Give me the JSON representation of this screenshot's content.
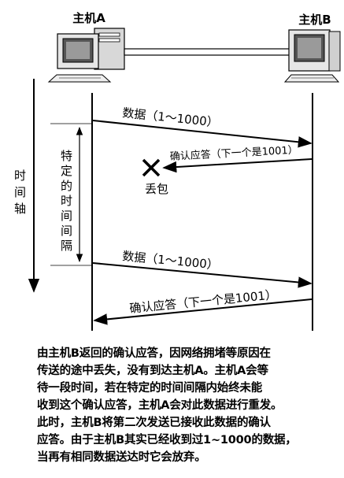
{
  "hosts": {
    "a": "主机A",
    "b": "主机B"
  },
  "time_axis": [
    "时",
    "间",
    "轴"
  ],
  "interval_label": [
    "特",
    "定",
    "的",
    "时",
    "间",
    "间",
    "隔"
  ],
  "messages": {
    "send1": "数据（1～1000）",
    "ack1": "确认应答（下一个是1001）",
    "lost": "丢包",
    "send2": "数据（1～1000）",
    "ack2": "确认应答（下一个是1001）"
  },
  "caption": [
    "由主机B返回的确认应答，因网络拥堵等原因在",
    "传送的途中丢失，没有到达主机A。主机A会等",
    "待一段时间，若在特定的时间间隔内始终未能",
    "收到这个确认应答，主机A会对此数据进行重发。",
    "此时，主机B将第二次发送已接收此数据的确认",
    "应答。由于主机B其实已经收到过1~1000的数据，",
    "当再有相同数据送达时它会放弃。"
  ]
}
